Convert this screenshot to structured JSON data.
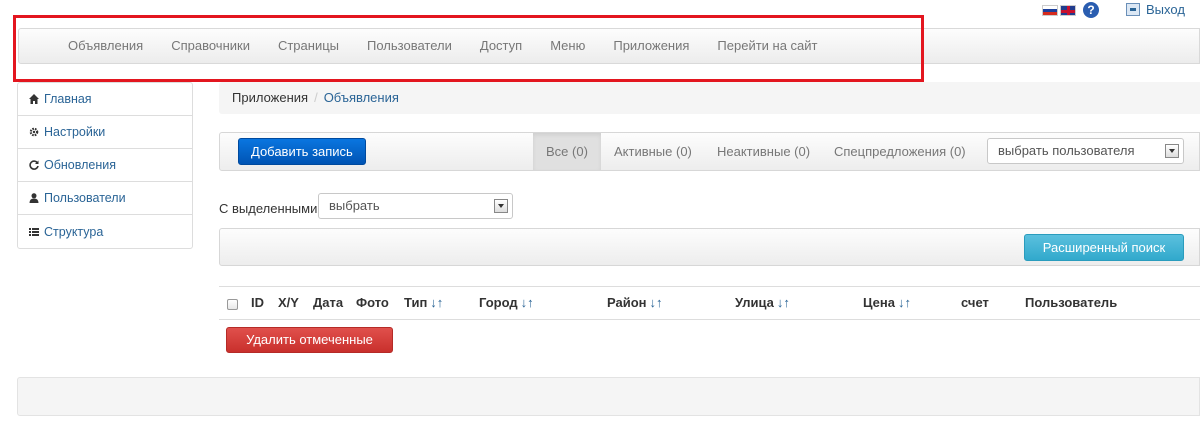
{
  "topbar": {
    "flags": [
      "flag-ru-icon",
      "flag-uk-icon"
    ],
    "help_icon_label": "?",
    "logout_label": "Выход"
  },
  "navbar": {
    "items": [
      "Объявления",
      "Справочники",
      "Страницы",
      "Пользователи",
      "Доступ",
      "Меню",
      "Приложения",
      "Перейти на сайт"
    ]
  },
  "sidebar": {
    "items": [
      {
        "label": "Главная",
        "icon": "home-icon"
      },
      {
        "label": "Настройки",
        "icon": "gear-icon"
      },
      {
        "label": "Обновления",
        "icon": "refresh-icon"
      },
      {
        "label": "Пользователи",
        "icon": "user-icon"
      },
      {
        "label": "Структура",
        "icon": "list-icon"
      }
    ]
  },
  "breadcrumb": {
    "items": [
      "Приложения",
      "Объявления"
    ],
    "separator": "/"
  },
  "filters": {
    "add_button": "Добавить запись",
    "tabs": [
      "Все (0)",
      "Активные (0)",
      "Неактивные (0)",
      "Спецпредложения (0)"
    ],
    "active_tab": "Все (0)",
    "user_select": "выбрать пользователя"
  },
  "bulk": {
    "label": "С выделенными",
    "select_value": "выбрать"
  },
  "search": {
    "advanced_button": "Расширенный поиск"
  },
  "table": {
    "columns": [
      "ID",
      "X/Y",
      "Дата",
      "Фото",
      "Тип",
      "Город",
      "Район",
      "Улица",
      "Цена",
      "счет",
      "Пользователь"
    ],
    "sort_arrows": "↓↑"
  },
  "actions": {
    "delete_selected": "Удалить отмеченные"
  },
  "colors": {
    "highlight": "#e3161f",
    "primary": "#0a76e0",
    "info": "#5bc0de",
    "danger": "#d9534f",
    "link": "#2a6496"
  }
}
